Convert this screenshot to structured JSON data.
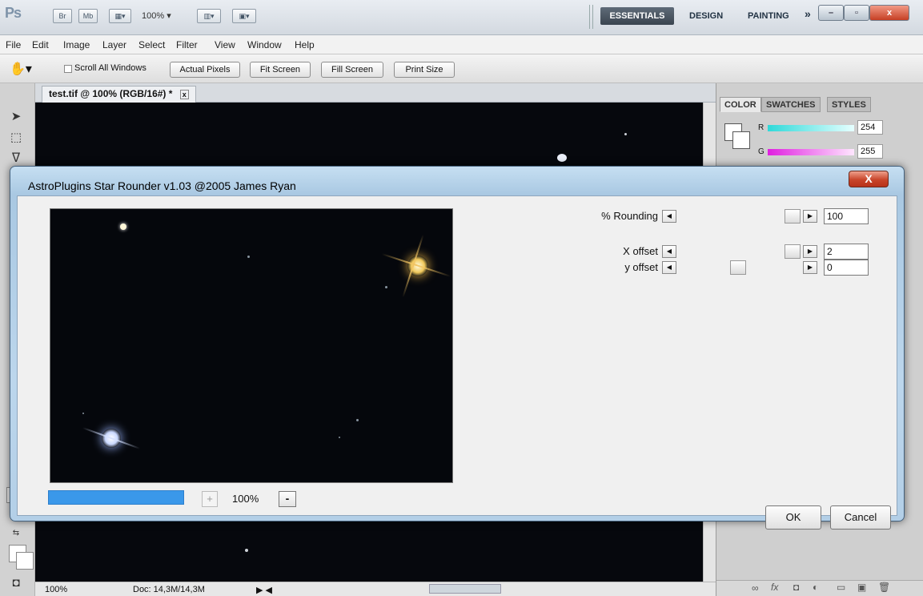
{
  "app": {
    "logo": "Ps",
    "bridge_label": "Br",
    "minibridge_label": "Mb",
    "zoom": "100% ▾",
    "workspaces": {
      "essentials": "ESSENTIALS",
      "design": "DESIGN",
      "painting": "PAINTING",
      "more": "»"
    },
    "window_controls": {
      "minimize": "–",
      "maximize": "▫",
      "close": "x"
    }
  },
  "menu": [
    "File",
    "Edit",
    "Image",
    "Layer",
    "Select",
    "Filter",
    "View",
    "Window",
    "Help"
  ],
  "options": {
    "scroll_all_windows": "Scroll All Windows",
    "actual_pixels": "Actual Pixels",
    "fit_screen": "Fit Screen",
    "fill_screen": "Fill Screen",
    "print_size": "Print Size"
  },
  "document": {
    "tab_title": "test.tif @ 100% (RGB/16#) *",
    "tab_close": "x",
    "status_zoom": "100%",
    "status_doc": "Doc: 14,3M/14,3M"
  },
  "panel": {
    "tabs": [
      "COLOR",
      "SWATCHES",
      "STYLES"
    ],
    "r_label": "R",
    "r_value": "254",
    "g_label": "G",
    "g_value": "255"
  },
  "dialog": {
    "title": "AstroPlugins Star Rounder v1.03  @2005 James Ryan",
    "close": "X",
    "zoom_plus": "+",
    "zoom_value": "100%",
    "zoom_minus": "-",
    "rounding_label": "% Rounding",
    "rounding_value": "100",
    "xoffset_label": "X offset",
    "xoffset_value": "2",
    "yoffset_label": "y offset",
    "yoffset_value": "0",
    "ok": "OK",
    "cancel": "Cancel",
    "progress": 1.0
  },
  "colors": {
    "accent_blue": "#3a98ea",
    "essentials_bg": "#3b4550",
    "close_red": "#c8452a"
  }
}
